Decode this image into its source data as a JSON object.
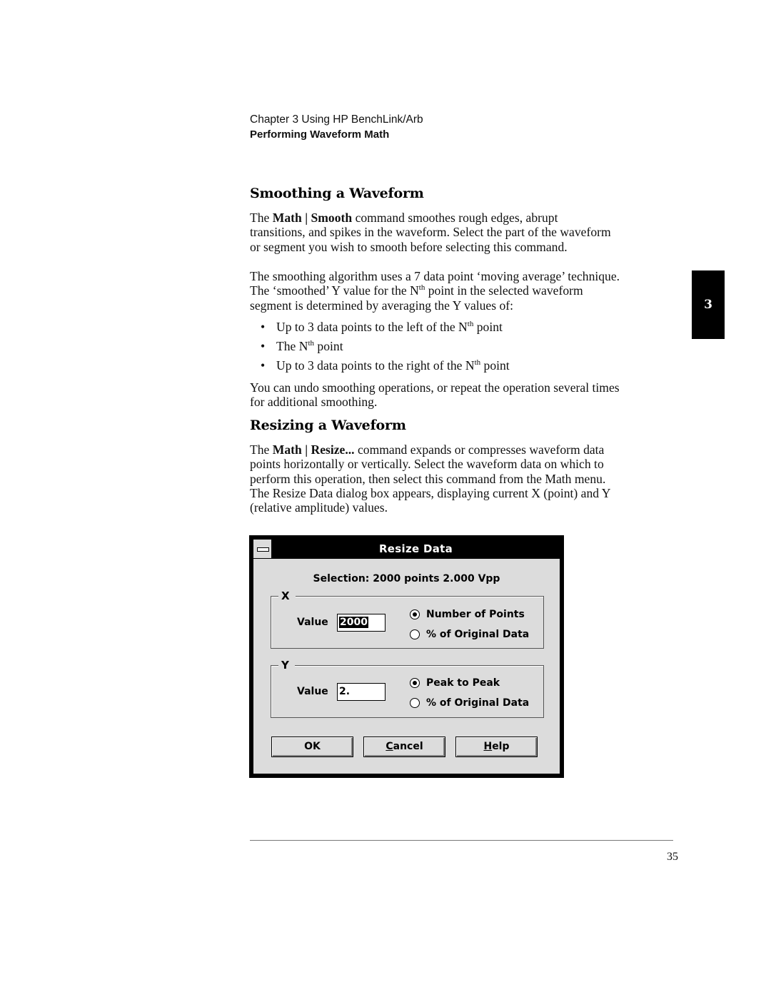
{
  "running_header": {
    "chapter": "Chapter 3  Using HP BenchLink/Arb",
    "section": "Performing Waveform Math"
  },
  "chapter_tab": "3",
  "smoothing": {
    "heading": "Smoothing a Waveform",
    "p1_pre": "The ",
    "p1_cmd1": "Math",
    "p1_sep": " | ",
    "p1_cmd2": "Smooth",
    "p1_line1_rest": " command smoothes rough edges, abrupt",
    "p1_line2": "transitions, and spikes in the waveform. Select the part of the waveform",
    "p1_line3": "or segment you wish to smooth before selecting this command.",
    "p2_line1": "The smoothing algorithm uses a 7 data point ‘moving average’ technique.",
    "p2_line2_pre": "The ‘smoothed’ Y value for the N",
    "p2_line2_sup": "th",
    "p2_line2_post": " point in the selected waveform",
    "p2_line3": "segment is determined by averaging the Y values of:",
    "bullets": [
      {
        "pre": "Up to 3 data points to the left of the N",
        "sup": "th",
        "post": " point"
      },
      {
        "pre": "The N",
        "sup": "th",
        "post": " point"
      },
      {
        "pre": "Up to 3 data points to the right of the N",
        "sup": "th",
        "post": " point"
      }
    ],
    "bullet_char": "•",
    "p3_line1": "You can undo smoothing operations, or repeat the operation several times",
    "p3_line2": "for additional smoothing."
  },
  "resizing": {
    "heading": "Resizing a Waveform",
    "p1_pre": "The ",
    "p1_cmd1": "Math",
    "p1_sep": " | ",
    "p1_cmd2": "Resize...",
    "p1_line1_rest": " command expands or compresses waveform data",
    "p1_line2": "points horizontally or vertically. Select the waveform data on which to",
    "p1_line3": "perform this operation, then select this command from the Math menu.",
    "p1_line4": "The Resize Data dialog box appears, displaying current X (point) and Y",
    "p1_line5": "(relative amplitude) values."
  },
  "dialog": {
    "title": "Resize Data",
    "system_menu_icon": "system-menu-icon",
    "selection": "Selection: 2000 points  2.000 Vpp",
    "x_group": {
      "label": "X",
      "value_label": "Value",
      "value": "2000",
      "options": [
        "Number of Points",
        "% of Original Data"
      ],
      "selected": "Number of Points"
    },
    "y_group": {
      "label": "Y",
      "value_label": "Value",
      "value": "2.",
      "options": [
        "Peak to Peak",
        "% of Original Data"
      ],
      "selected": "Peak to Peak"
    },
    "buttons": {
      "ok": "OK",
      "cancel_mnemonic": "C",
      "cancel_rest": "ancel",
      "help_mnemonic": "H",
      "help_rest": "elp"
    }
  },
  "page_number": "35"
}
